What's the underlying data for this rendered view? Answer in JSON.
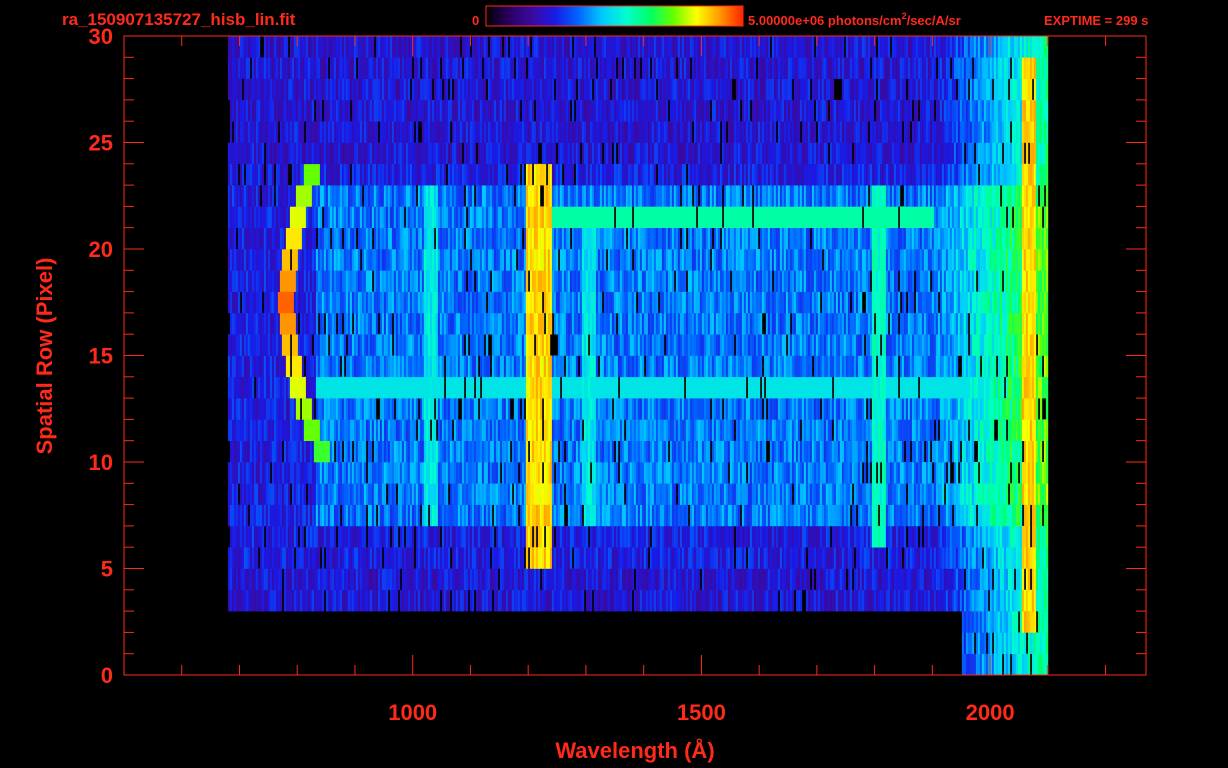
{
  "header": {
    "filename": "ra_150907135727_hisb_lin.fit",
    "colorbar_min": "0",
    "colorbar_max_prefix": "5.00000e+06 photons/cm",
    "colorbar_max_sup": "2",
    "colorbar_max_suffix": "/sec/A/sr",
    "exptime": "EXPTIME = 299 s"
  },
  "colors": {
    "text": "#ff2a1a",
    "axes": "#ff2a1a",
    "background": "#000000",
    "colormap": [
      "#000000",
      "#2a0060",
      "#3a0aa0",
      "#1a1ae6",
      "#0066ff",
      "#00c8ff",
      "#00ffcc",
      "#00ff66",
      "#66ff00",
      "#ffff00",
      "#ff9900",
      "#ff2200"
    ]
  },
  "chart_data": {
    "type": "heatmap",
    "title": "",
    "xlabel": "Wavelength (Å)",
    "ylabel": "Spatial Row (Pixel)",
    "xlim": [
      500,
      2270
    ],
    "ylim": [
      0,
      30
    ],
    "x_ticks": [
      "1000",
      "1500",
      "2000"
    ],
    "y_ticks": [
      "0",
      "5",
      "10",
      "15",
      "20",
      "25",
      "30"
    ],
    "colorbar": {
      "min": 0,
      "max": 5000000,
      "units": "photons/cm^2/sec/A/sr"
    },
    "grid": false,
    "features": [
      {
        "wavelength": 1216,
        "rows": [
          5,
          24
        ],
        "level": 0.85
      },
      {
        "wavelength": 1030,
        "rows": [
          7,
          23
        ],
        "level": 0.5
      },
      {
        "wavelength": 1304,
        "rows": [
          7,
          22
        ],
        "level": 0.5
      },
      {
        "wavelength": 1806,
        "rows": [
          6,
          23
        ],
        "level": 0.55
      },
      {
        "wavelength": 2065,
        "rows": [
          2,
          29
        ],
        "level": 0.85
      }
    ],
    "band": {
      "wavelength_start": 830,
      "wavelength_end": 2060,
      "row_start": 7,
      "row_end": 23
    },
    "arc": {
      "wavelength_min": 780,
      "rows": [
        10,
        24
      ]
    }
  }
}
